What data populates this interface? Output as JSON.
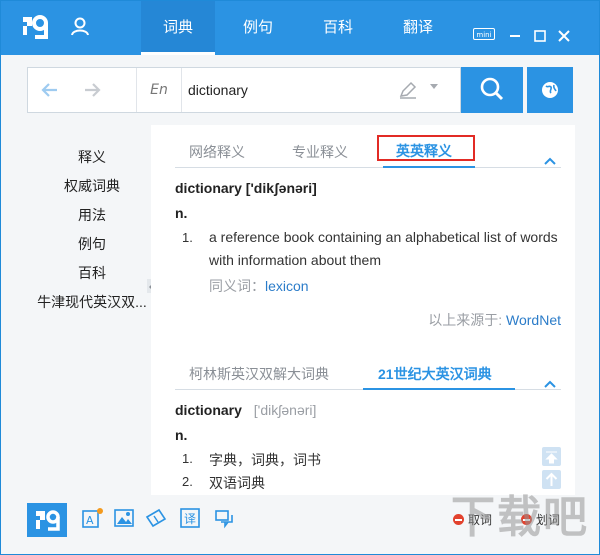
{
  "nav": {
    "tabs": [
      "词典",
      "例句",
      "百科",
      "翻译"
    ],
    "active_tab": "词典",
    "mini_label": "mini"
  },
  "search": {
    "lang": "En",
    "query": "dictionary"
  },
  "sidebar": {
    "items": [
      "释义",
      "权威词典",
      "用法",
      "例句",
      "百科",
      "牛津现代英汉双..."
    ]
  },
  "section1": {
    "tabs": [
      "网络释义",
      "专业释义",
      "英英释义"
    ],
    "active_tab": "英英释义",
    "headword": "dictionary",
    "phonetic": "['dikʃənəri]",
    "pos": "n.",
    "definition": {
      "number": "1.",
      "line1": "a reference book containing an alphabetical list of words",
      "line2": "with information about them"
    },
    "synonym_label": "同义词：",
    "synonym": "lexicon",
    "source_label": "以上来源于: ",
    "source": "WordNet"
  },
  "section2": {
    "tabs": [
      "柯林斯英汉双解大词典",
      "21世纪大英汉词典"
    ],
    "active_tab": "21世纪大英汉词典",
    "headword": "dictionary",
    "phonetic": "['dikʃənəri]",
    "pos": "n.",
    "senses": [
      {
        "number": "1.",
        "text": "字典，词典，词书"
      },
      {
        "number": "2.",
        "text": "双语词典"
      }
    ]
  },
  "bottom": {
    "checkboxes": [
      "取词",
      "划词"
    ]
  },
  "watermark": "下载吧"
}
